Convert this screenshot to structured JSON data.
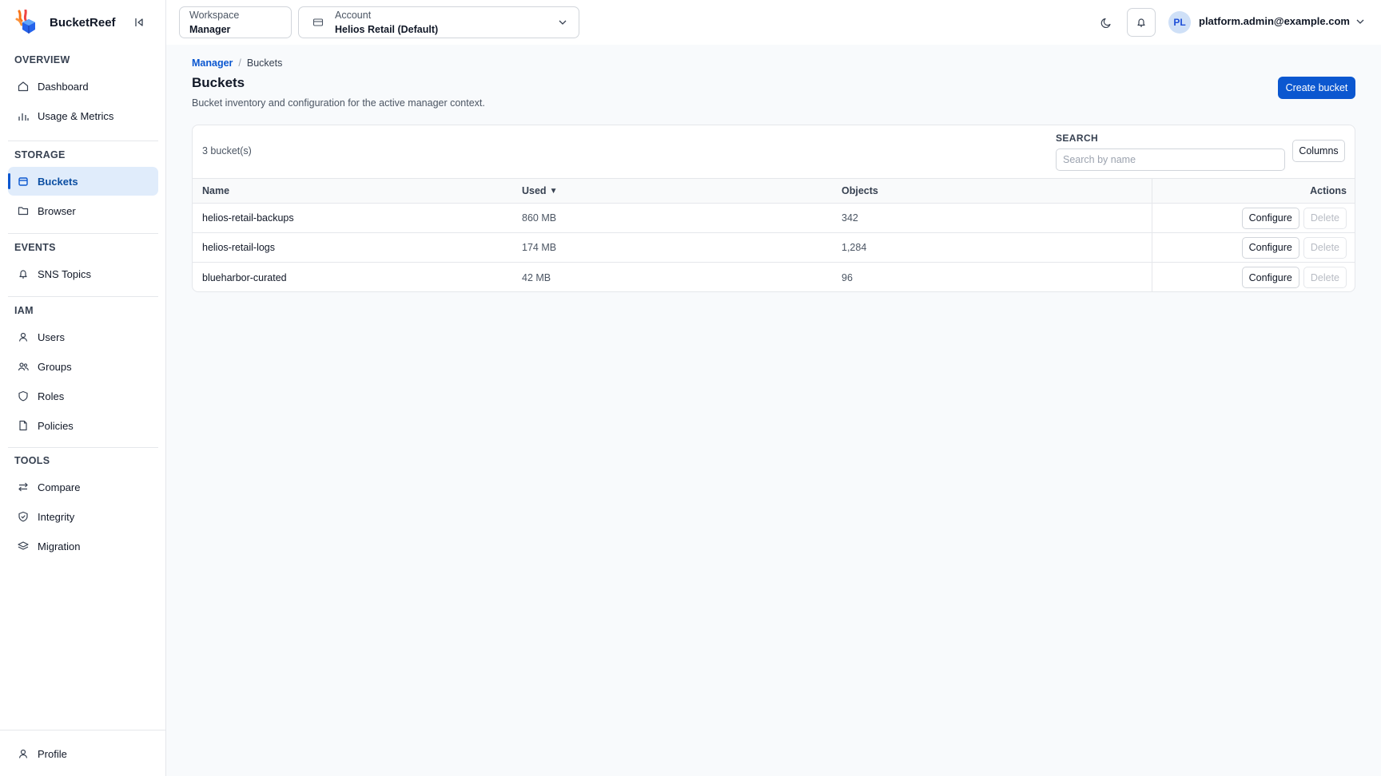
{
  "app": {
    "name": "BucketReef"
  },
  "sidebar": {
    "sections": [
      {
        "title": "OVERVIEW",
        "items": [
          {
            "label": "Dashboard",
            "icon": "home-icon"
          },
          {
            "label": "Usage & Metrics",
            "icon": "bar-chart-icon"
          }
        ]
      },
      {
        "title": "STORAGE",
        "items": [
          {
            "label": "Buckets",
            "icon": "bucket-icon",
            "active": true
          },
          {
            "label": "Browser",
            "icon": "folder-icon"
          }
        ]
      },
      {
        "title": "EVENTS",
        "items": [
          {
            "label": "SNS Topics",
            "icon": "bell-icon"
          }
        ]
      },
      {
        "title": "IAM",
        "items": [
          {
            "label": "Users",
            "icon": "user-icon"
          },
          {
            "label": "Groups",
            "icon": "users-icon"
          },
          {
            "label": "Roles",
            "icon": "shield-icon"
          },
          {
            "label": "Policies",
            "icon": "file-icon"
          }
        ]
      },
      {
        "title": "TOOLS",
        "items": [
          {
            "label": "Compare",
            "icon": "compare-icon"
          },
          {
            "label": "Integrity",
            "icon": "shield-check-icon"
          },
          {
            "label": "Migration",
            "icon": "layers-icon"
          }
        ]
      }
    ],
    "footer": {
      "label": "Profile",
      "icon": "user-icon"
    }
  },
  "topbar": {
    "workspace": {
      "label": "Workspace",
      "value": "Manager"
    },
    "account": {
      "label": "Account",
      "value": "Helios Retail (Default)"
    },
    "user": {
      "initials": "PL",
      "email": "platform.admin@example.com"
    }
  },
  "breadcrumb": {
    "parent": "Manager",
    "separator": "/",
    "current": "Buckets"
  },
  "page": {
    "title": "Buckets",
    "subtitle": "Bucket inventory and configuration for the active manager context.",
    "create_label": "Create bucket"
  },
  "table_card": {
    "count_text": "3 bucket(s)",
    "search_label": "SEARCH",
    "search_placeholder": "Search by name",
    "search_value": "",
    "columns_label": "Columns",
    "headers": {
      "name": "Name",
      "used": "Used",
      "objects": "Objects",
      "actions": "Actions"
    },
    "sort_indicator": "▼",
    "rows": [
      {
        "name": "helios-retail-backups",
        "used": "860 MB",
        "objects": "342",
        "configure": "Configure",
        "delete": "Delete"
      },
      {
        "name": "helios-retail-logs",
        "used": "174 MB",
        "objects": "1,284",
        "configure": "Configure",
        "delete": "Delete"
      },
      {
        "name": "blueharbor-curated",
        "used": "42 MB",
        "objects": "96",
        "configure": "Configure",
        "delete": "Delete"
      }
    ]
  },
  "colors": {
    "accent": "#0b57d0",
    "active_bg": "#e0ecfb",
    "brand_orange": "#f97316"
  }
}
